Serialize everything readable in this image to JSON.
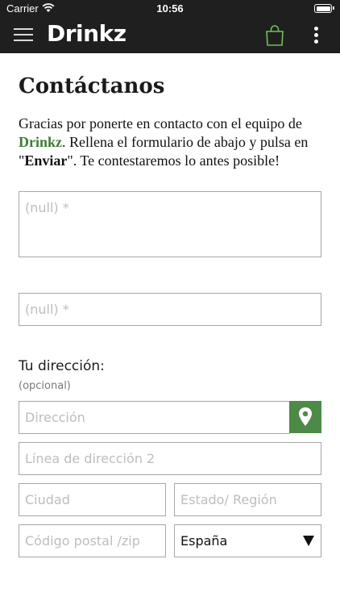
{
  "status_bar": {
    "carrier": "Carrier",
    "time": "10:56"
  },
  "navbar": {
    "brand": "Drinkz",
    "menu_icon": "hamburger-menu-icon",
    "cart_icon": "shopping-bag-icon",
    "more_icon": "more-vertical-icon"
  },
  "page": {
    "title": "Contáctanos",
    "intro": {
      "part1": "Gracias por ponerte en contacto con el equipo de ",
      "brand": "Drinkz",
      "part2": ". Rellena el formulario de abajo y pulsa en ",
      "quote_open": "\"",
      "action": "Enviar",
      "quote_close": "\"",
      "part3": ". Te contestaremos lo antes posible!"
    }
  },
  "form": {
    "message_placeholder": "(null) *",
    "second_placeholder": "(null) *",
    "address_label": "Tu dirección:",
    "address_optional": "(opcional)",
    "address_placeholder": "Dirección",
    "address2_placeholder": "Línea de dirección 2",
    "city_placeholder": "Ciudad",
    "state_placeholder": "Estado/ Región",
    "zip_placeholder": "Código postal /zip",
    "country_value": "España"
  },
  "colors": {
    "accent": "#4e8a47",
    "brand_green": "#3f7a39",
    "navbar": "#1f1f1f"
  }
}
